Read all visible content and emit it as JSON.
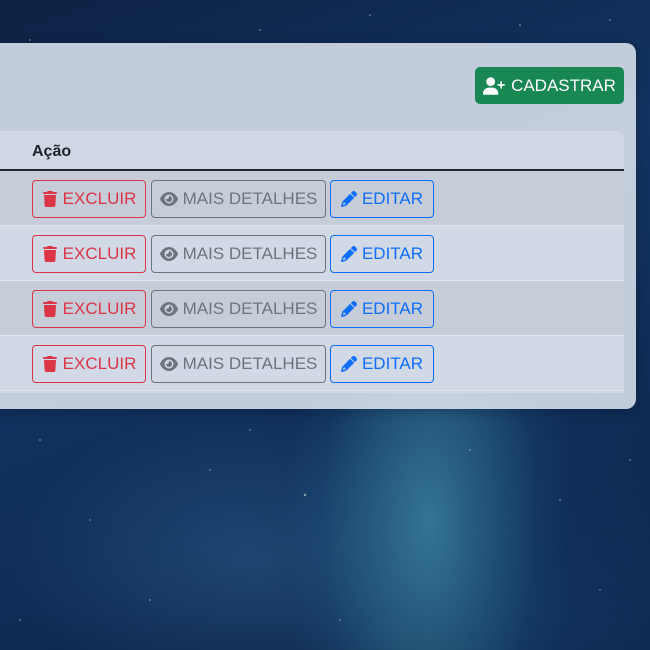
{
  "header": {
    "register_label": "CADASTRAR"
  },
  "table": {
    "column_action": "Ação",
    "rows": [
      {
        "delete_label": "EXCLUIR",
        "details_label": "MAIS DETALHES",
        "edit_label": "EDITAR"
      },
      {
        "delete_label": "EXCLUIR",
        "details_label": "MAIS DETALHES",
        "edit_label": "EDITAR"
      },
      {
        "delete_label": "EXCLUIR",
        "details_label": "MAIS DETALHES",
        "edit_label": "EDITAR"
      },
      {
        "delete_label": "EXCLUIR",
        "details_label": "MAIS DETALHES",
        "edit_label": "EDITAR"
      }
    ]
  },
  "colors": {
    "success": "#198754",
    "danger": "#dc3545",
    "secondary": "#6c757d",
    "primary": "#0d6efd"
  },
  "icons": {
    "register": "user-plus-icon",
    "delete": "trash-icon",
    "details": "eye-icon",
    "edit": "pencil-icon"
  }
}
